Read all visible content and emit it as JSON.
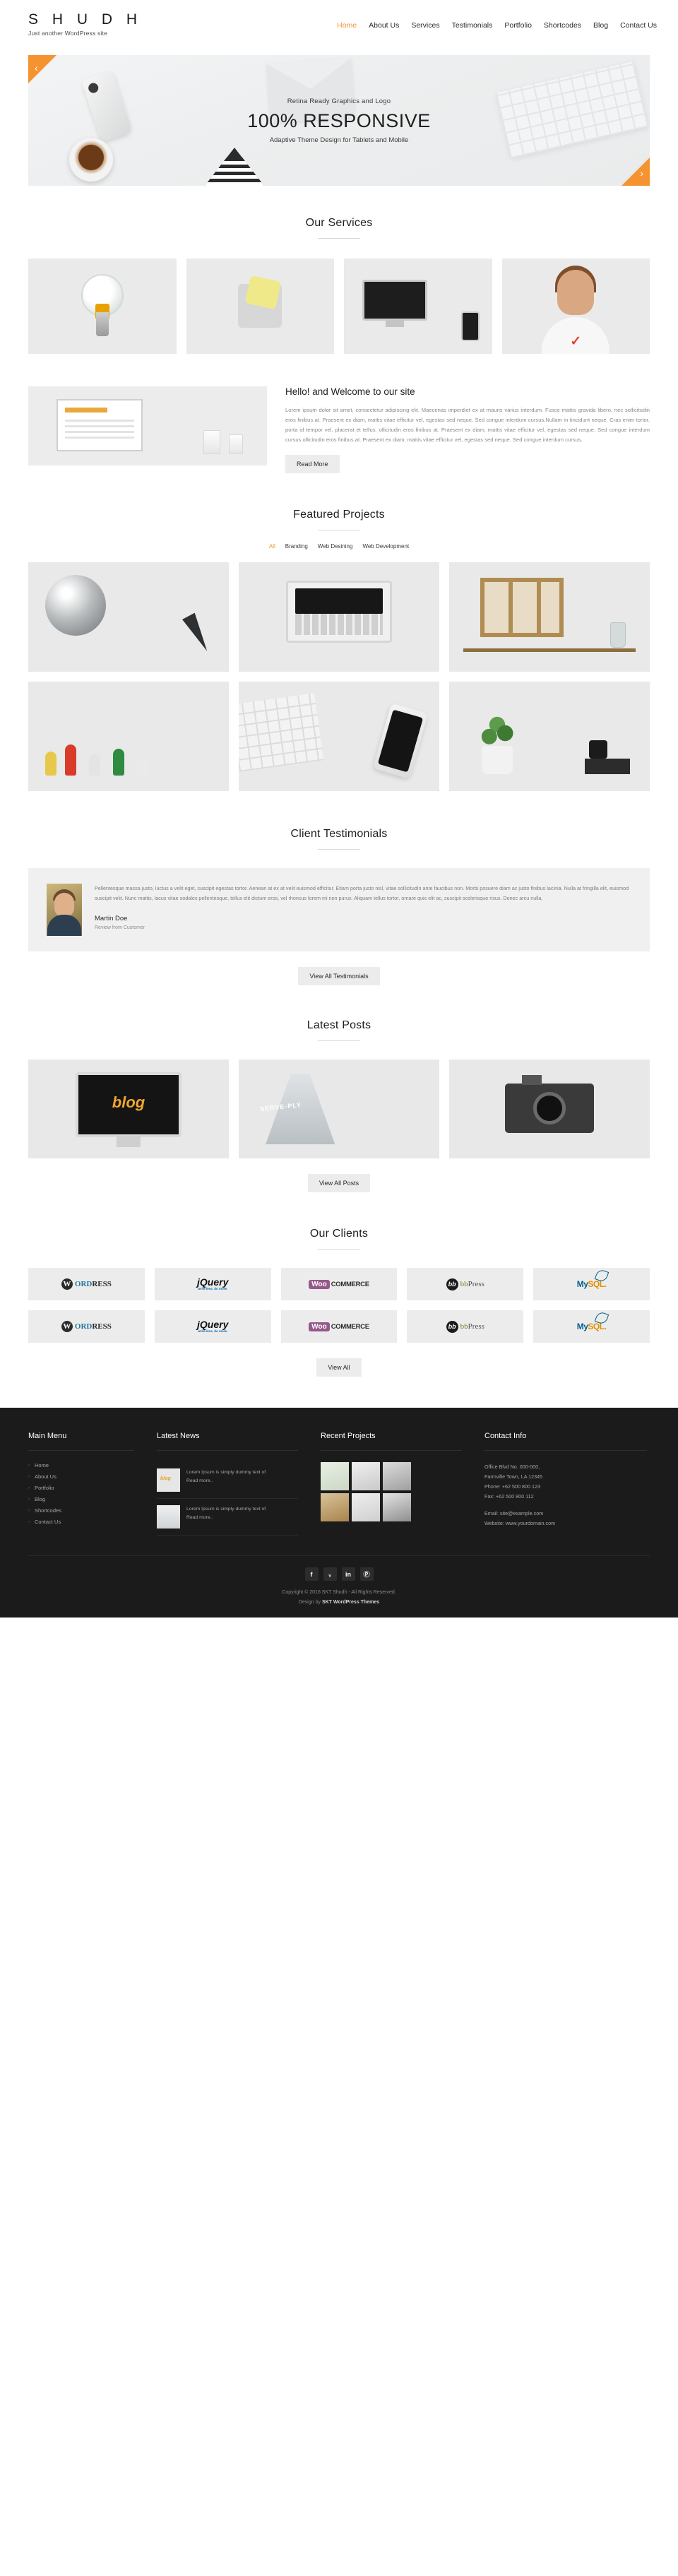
{
  "header": {
    "logo_title": "S H U D H",
    "logo_tagline": "Just another WordPress site",
    "nav": [
      {
        "label": "Home",
        "active": true
      },
      {
        "label": "About Us",
        "active": false
      },
      {
        "label": "Services",
        "active": false
      },
      {
        "label": "Testimonials",
        "active": false
      },
      {
        "label": "Portfolio",
        "active": false
      },
      {
        "label": "Shortcodes",
        "active": false
      },
      {
        "label": "Blog",
        "active": false
      },
      {
        "label": "Contact Us",
        "active": false
      }
    ]
  },
  "slider": {
    "subtitle_top": "Retina Ready Graphics and Logo",
    "title": "100% RESPONSIVE",
    "subtitle_bottom": "Adaptive Theme Design for Tablets and Mobile",
    "prev_icon": "‹",
    "next_icon": "›",
    "accent_color": "#f59331"
  },
  "services": {
    "title": "Our Services",
    "cards": [
      {
        "name": "lightbulb-service"
      },
      {
        "name": "puzzle-service"
      },
      {
        "name": "responsive-devices-service"
      },
      {
        "name": "support-agent-service"
      }
    ]
  },
  "welcome": {
    "title": "Hello! and Welcome to our site",
    "text": "Lorem ipsum dolor sit amet, consectetur adipiscing elit. Maecenas imperdiet ex at mauris varius interdum. Fusce mattis gravida libero, nec sollicitudin eros finibus at. Praesent ex diam, mattis vitae efficitur vel, egestas sed neque. Sed congue interdum cursus.Nullam in tincidunt neque. Cras enim tortor, porta id tempor vel, placerat et tellus. ollicitudin eros finibus at. Praesent ex diam, mattis vitae efficitur vel, egestas sed neque. Sed congue interdum cursus ollicitudin eros finibus at. Praesent ex diam, mattis vitae efficitur vel, egestas sed neque. Sed congue interdum cursus.",
    "button": "Read More"
  },
  "projects": {
    "title": "Featured Projects",
    "filters": [
      {
        "label": "All",
        "active": true
      },
      {
        "label": "Branding",
        "active": false
      },
      {
        "label": "Web Desining",
        "active": false
      },
      {
        "label": "Web Development",
        "active": false
      }
    ]
  },
  "testimonials": {
    "title": "Client Testimonials",
    "text": "Pellentesque massa justo, luctus a velit eget, suscipit egestas tortor. Aenean at ex at velit euismod efficitur. Etiam porta justo nisl, vitae sollicitudin ante faucibus non. Morbi posuere diam ac justo finibus lacinia. Nulla at fringilla elit, euismod suscipit velit. Nunc mattis, lacus vitae sodales pellentesque, tellus elit dictum eros, vel rhoncus lorem mi non purus. Aliquam tellus tortor, ornare quis elit ac, suscipit scelerisque risus. Donec arcu nulla,",
    "author": "Martin Doe",
    "role": "Review from Customer",
    "button": "View All Testimonials"
  },
  "posts": {
    "title": "Latest Posts",
    "button": "View All Posts",
    "cards": [
      {
        "name": "imac-blog-post",
        "label": "blog"
      },
      {
        "name": "crane-post",
        "label": "SERVE-PLY"
      },
      {
        "name": "camera-post",
        "label": ""
      }
    ]
  },
  "clients": {
    "title": "Our Clients",
    "button": "View All",
    "logos": [
      {
        "name": "wordpress-logo",
        "mark": "W",
        "word1": "W",
        "word2": "ORD",
        "word3": "P",
        "word4": "RESS"
      },
      {
        "name": "jquery-logo",
        "main": "jQuery",
        "sub": "write less, do more."
      },
      {
        "name": "woocommerce-logo",
        "badge": "Woo",
        "text": "COMMERCE"
      },
      {
        "name": "bbpress-logo",
        "mark": "bb",
        "word1": "bb",
        "word2": "Press"
      },
      {
        "name": "mysql-logo",
        "word1": "My",
        "word2": "SQL."
      }
    ]
  },
  "footer": {
    "main_menu": {
      "title": "Main Menu",
      "items": [
        "Home",
        "About Us",
        "Portfolio",
        "Blog",
        "Shortcodes",
        "Contact Us"
      ]
    },
    "latest_news": {
      "title": "Latest News",
      "items": [
        {
          "text": "Lorem Ipsum is simply dummy text of",
          "more": "Read more.."
        },
        {
          "text": "Lorem Ipsum is simply dummy text of",
          "more": "Read more.."
        }
      ]
    },
    "recent_projects": {
      "title": "Recent Projects",
      "count": 6
    },
    "contact_info": {
      "title": "Contact Info",
      "address_line1": "Office Blvd No. 000-000,",
      "address_line2": "Farmville Town, LA 12345",
      "phone": "Phone: +62 500 800 123",
      "fax": "Fax: +62 500 800 112",
      "email": "Email: site@example.com",
      "website": "Website: www.yourdomain.com"
    },
    "socials": [
      {
        "name": "facebook-icon",
        "glyph": "f"
      },
      {
        "name": "twitter-icon",
        "glyph": "ᵥ"
      },
      {
        "name": "linkedin-icon",
        "glyph": "in"
      },
      {
        "name": "pinterest-icon",
        "glyph": "Ⓟ"
      }
    ],
    "copyright": "Copyright © 2016 SKT Shudh - All Rights Reserved.",
    "design_by_prefix": "Design by ",
    "design_by": "SKT WordPress Themes"
  }
}
